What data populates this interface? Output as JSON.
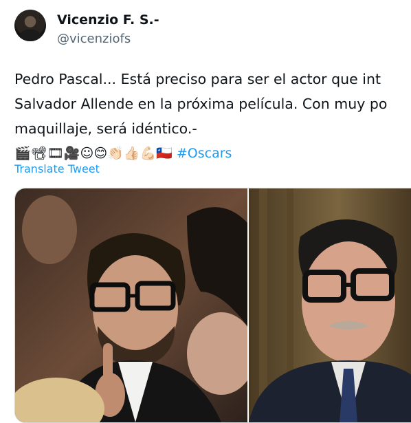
{
  "author": {
    "display_name": "Vicenzio F. S.-",
    "handle": "@vicenziofs",
    "avatar_icon": "profile-avatar"
  },
  "tweet": {
    "text_line1": "Pedro Pascal... Está preciso para ser el actor que int",
    "text_line2": "Salvador Allende en la próxima película. Con muy po",
    "text_line3": "maquillaje, será idéntico.-",
    "emojis": "🎬📽🎞🎥☺😊👏🏻👍🏻💪🏻🇨🇱",
    "hashtag": "#Oscars",
    "translate_label": "Translate Tweet"
  },
  "media": {
    "left_photo_icon": "photo-man-glasses-pointing",
    "right_photo_icon": "photo-man-glasses-portrait"
  },
  "colors": {
    "link": "#1d9bf0",
    "secondary_text": "#536471",
    "border": "#cfd9de"
  }
}
